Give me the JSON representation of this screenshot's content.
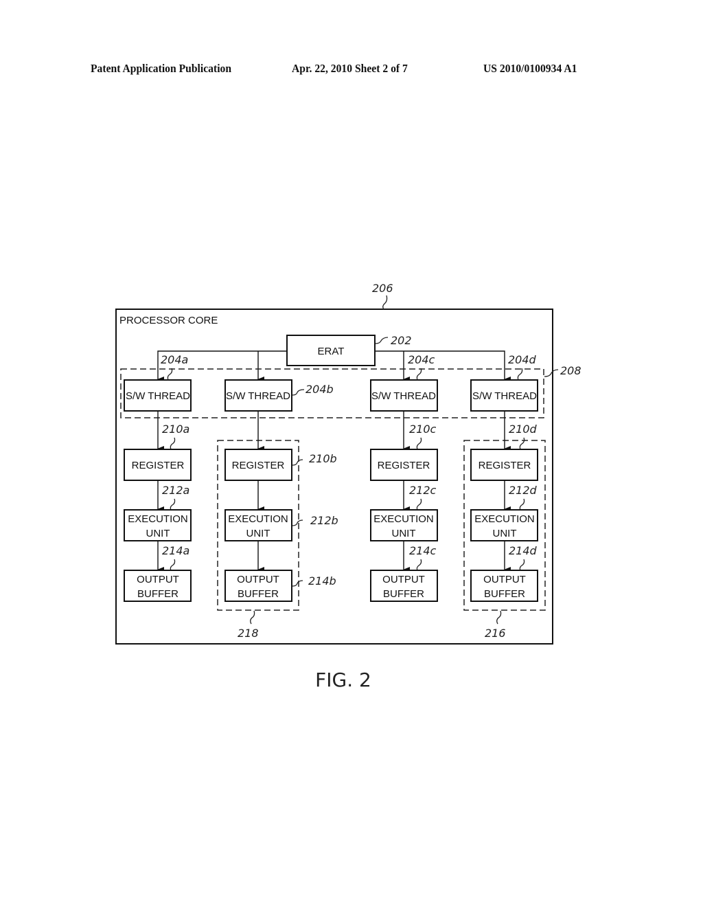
{
  "header": {
    "publication": "Patent Application Publication",
    "date_sheet": "Apr. 22, 2010  Sheet 2 of 7",
    "number": "US 2010/0100934 A1"
  },
  "diagram": {
    "figure_label": "FIG. 2",
    "processor_core": {
      "label": "PROCESSOR CORE",
      "ref": "206"
    },
    "erat": {
      "label": "ERAT",
      "ref": "202"
    },
    "thread_group_ref": "208",
    "group_b_ref": "218",
    "group_d_ref": "216",
    "columns": [
      {
        "thread": "S/W THREAD",
        "thread_ref": "204a",
        "register": "REGISTER",
        "register_ref": "210a",
        "exec_line1": "EXECUTION",
        "exec_line2": "UNIT",
        "exec_ref": "212a",
        "out_line1": "OUTPUT",
        "out_line2": "BUFFER",
        "out_ref": "214a"
      },
      {
        "thread": "S/W THREAD",
        "thread_ref": "204b",
        "register": "REGISTER",
        "register_ref": "210b",
        "exec_line1": "EXECUTION",
        "exec_line2": "UNIT",
        "exec_ref": "212b",
        "out_line1": "OUTPUT",
        "out_line2": "BUFFER",
        "out_ref": "214b"
      },
      {
        "thread": "S/W THREAD",
        "thread_ref": "204c",
        "register": "REGISTER",
        "register_ref": "210c",
        "exec_line1": "EXECUTION",
        "exec_line2": "UNIT",
        "exec_ref": "212c",
        "out_line1": "OUTPUT",
        "out_line2": "BUFFER",
        "out_ref": "214c"
      },
      {
        "thread": "S/W THREAD",
        "thread_ref": "204d",
        "register": "REGISTER",
        "register_ref": "210d",
        "exec_line1": "EXECUTION",
        "exec_line2": "UNIT",
        "exec_ref": "212d",
        "out_line1": "OUTPUT",
        "out_line2": "BUFFER",
        "out_ref": "214d"
      }
    ]
  }
}
